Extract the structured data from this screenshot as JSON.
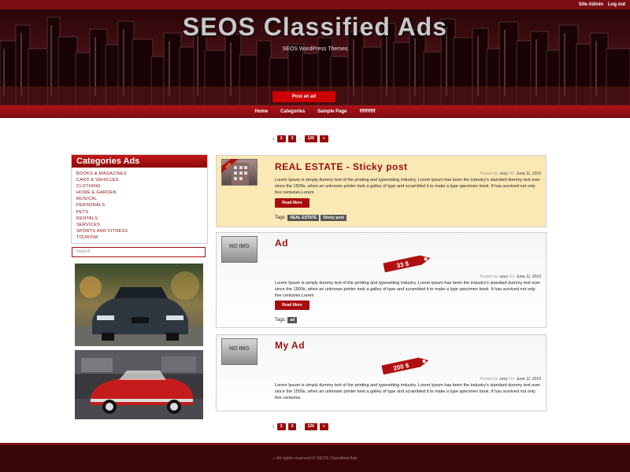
{
  "header": {
    "admin_links": [
      "Site Admin",
      "Log out"
    ],
    "title": "SEOS Classified Ads",
    "tagline": "SEOS WordPress Themes",
    "post_ad_label": "Post an ad"
  },
  "nav": {
    "items": [
      "Home",
      "Categories",
      "Sample Page",
      "ffffffffff"
    ]
  },
  "pagination": {
    "pages": [
      "1",
      "2",
      "3",
      "...",
      "126",
      "»"
    ]
  },
  "sidebar": {
    "categories_title": "Categories Ads",
    "categories": [
      "BOOKS & MAGAZINES",
      "CARS & VEHICLES",
      "CLOTHING",
      "HOME & GARDEN",
      "MUSICAL",
      "PERSONALS",
      "PETS",
      "RENTALS",
      "SERVICES",
      "SPORTS AND FITNESS",
      "TOURISM"
    ],
    "search_placeholder": "Search"
  },
  "posts": [
    {
      "title": "REAL ESTATE - Sticky post",
      "meta_posted_by": "Posted by:",
      "author": "cecy",
      "meta_on": "On:",
      "date": "June 11, 2015",
      "excerpt": "Lorem Ipsum is simply dummy text of the printing and typesetting industry. Lorem Ipsum has been the industry's standard dummy text ever since the 1500s, when an unknown printer took a galley of type and scrambled it to make a type specimen book. It has survived not only five centuries.Lorem",
      "read_more": "Read More",
      "tags_label": "Tags:",
      "tags": [
        "REAL ESTATE",
        "Sticky post"
      ],
      "badge": "VIP"
    },
    {
      "title": "Ad",
      "thumb_text": "NO IMG",
      "price": "33 $",
      "meta_posted_by": "Posted by:",
      "author": "cecy",
      "meta_on": "On:",
      "date": "June 11, 2015",
      "excerpt": "Lorem Ipsum is simply dummy text of the printing and typesetting industry. Lorem Ipsum has been the industry's standard dummy text ever since the 1500s, when an unknown printer took a galley of type and scrambled it to make a type specimen book. It has survived not only five centuries.Lorem",
      "read_more": "Read More",
      "tags_label": "Tags:",
      "tags": [
        "ad"
      ]
    },
    {
      "title": "My Ad",
      "thumb_text": "NO IMG",
      "price": "200 $",
      "meta_posted_by": "Posted by:",
      "author": "cecy",
      "meta_on": "On:",
      "date": "June 11, 2015",
      "excerpt": "Lorem Ipsum is simply dummy text of the printing and typesetting industry. Lorem Ipsum has been the industry's standard dummy text ever since the 1500s, when an unknown printer took a galley of type and scrambled it to make a type specimen book. It has survived not only five centuries."
    }
  ],
  "footer": {
    "text": "» All rights reserved © SEOS Classified Ads"
  },
  "colors": {
    "brand_red": "#9a0c0c",
    "header_dark": "#3a0c12",
    "sticky_bg": "#fbe9b5"
  }
}
